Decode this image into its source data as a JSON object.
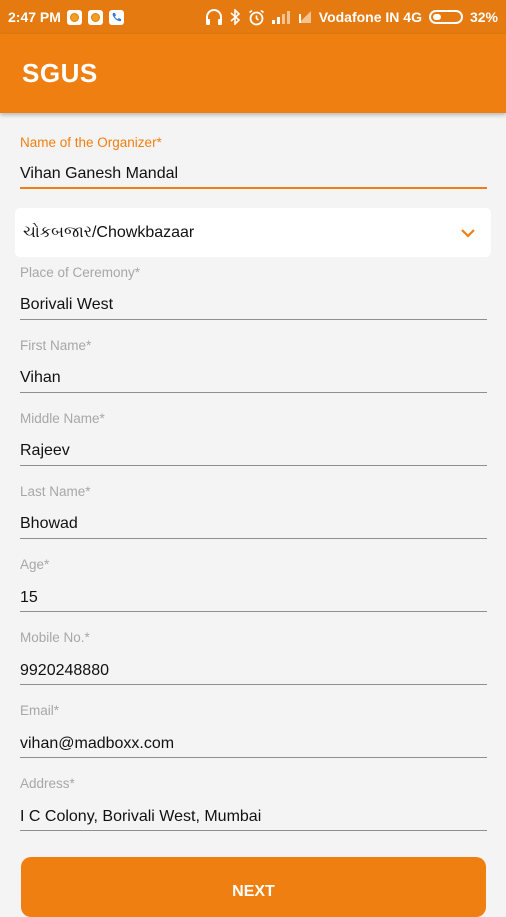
{
  "status": {
    "time": "2:47 PM",
    "carrier": "Vodafone IN 4G",
    "battery": "32%",
    "battery_level": 0.32
  },
  "app": {
    "title": "SGUS"
  },
  "form": {
    "organizer": {
      "label": "Name of the Organizer*",
      "value": "Vihan Ganesh Mandal"
    },
    "area": {
      "value": "ચોકબજાર/Chowkbazaar"
    },
    "place": {
      "label": "Place of Ceremony*",
      "value": "Borivali West"
    },
    "first_name": {
      "label": "First Name*",
      "value": "Vihan"
    },
    "middle_name": {
      "label": "Middle Name*",
      "value": "Rajeev"
    },
    "last_name": {
      "label": "Last Name*",
      "value": "Bhowad"
    },
    "age": {
      "label": "Age*",
      "value": "15"
    },
    "mobile": {
      "label": "Mobile No.*",
      "value": "9920248880"
    },
    "email": {
      "label": "Email*",
      "value": "vihan@madboxx.com"
    },
    "address": {
      "label": "Address*",
      "value": "I C Colony, Borivali West, Mumbai"
    }
  },
  "buttons": {
    "next": "NEXT"
  },
  "colors": {
    "accent": "#f07f12",
    "statusbar": "#e47a10"
  }
}
